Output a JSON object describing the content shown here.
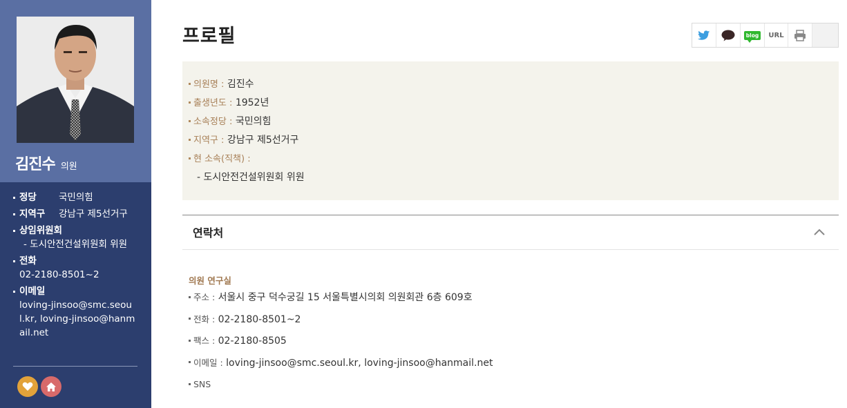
{
  "sidebar": {
    "name": "김진수",
    "title": "의원",
    "party_label": "정당",
    "party_value": "국민의힘",
    "district_label": "지역구",
    "district_value": "강남구 제5선거구",
    "committee_label": "상임위원회",
    "committee_value": "- 도시안전건설위원회 위원",
    "phone_label": "전화",
    "phone_value": "02-2180-8501~2",
    "email_label": "이메일",
    "email_value": "loving-jinsoo@smc.seoul.kr, loving-jinsoo@hanmail.net",
    "heart_icon": "heart-icon",
    "home_icon": "home-icon",
    "accent_heart": "#e2a23a",
    "accent_home": "#d86a6a"
  },
  "page": {
    "title": "프로필"
  },
  "share": {
    "twitter_icon": "twitter-icon",
    "kakao_icon": "speech-bubble-icon",
    "blog_label": "blog",
    "url_label": "URL",
    "print_icon": "printer-icon"
  },
  "profile": {
    "name_label": "의원명 :",
    "name_value": "김진수",
    "birth_label": "출생년도 :",
    "birth_value": "1952년",
    "party_label": "소속정당 :",
    "party_value": "국민의힘",
    "district_label": "지역구 :",
    "district_value": "강남구 제5선거구",
    "position_label": "현 소속(직책) :",
    "position_value": "- 도시안전건설위원회 위원"
  },
  "contact": {
    "header": "연락처",
    "section": "의원 연구실",
    "address_label": "주소 :",
    "address_value": "서울시 중구 덕수궁길 15 서울특별시의회 의원회관 6층 609호",
    "phone_label": "전화 :",
    "phone_value": "02-2180-8501~2",
    "fax_label": "팩스 :",
    "fax_value": "02-2180-8505",
    "email_label": "이메일 :",
    "email_value": "loving-jinsoo@smc.seoul.kr, loving-jinsoo@hanmail.net",
    "sns_label": "SNS"
  }
}
